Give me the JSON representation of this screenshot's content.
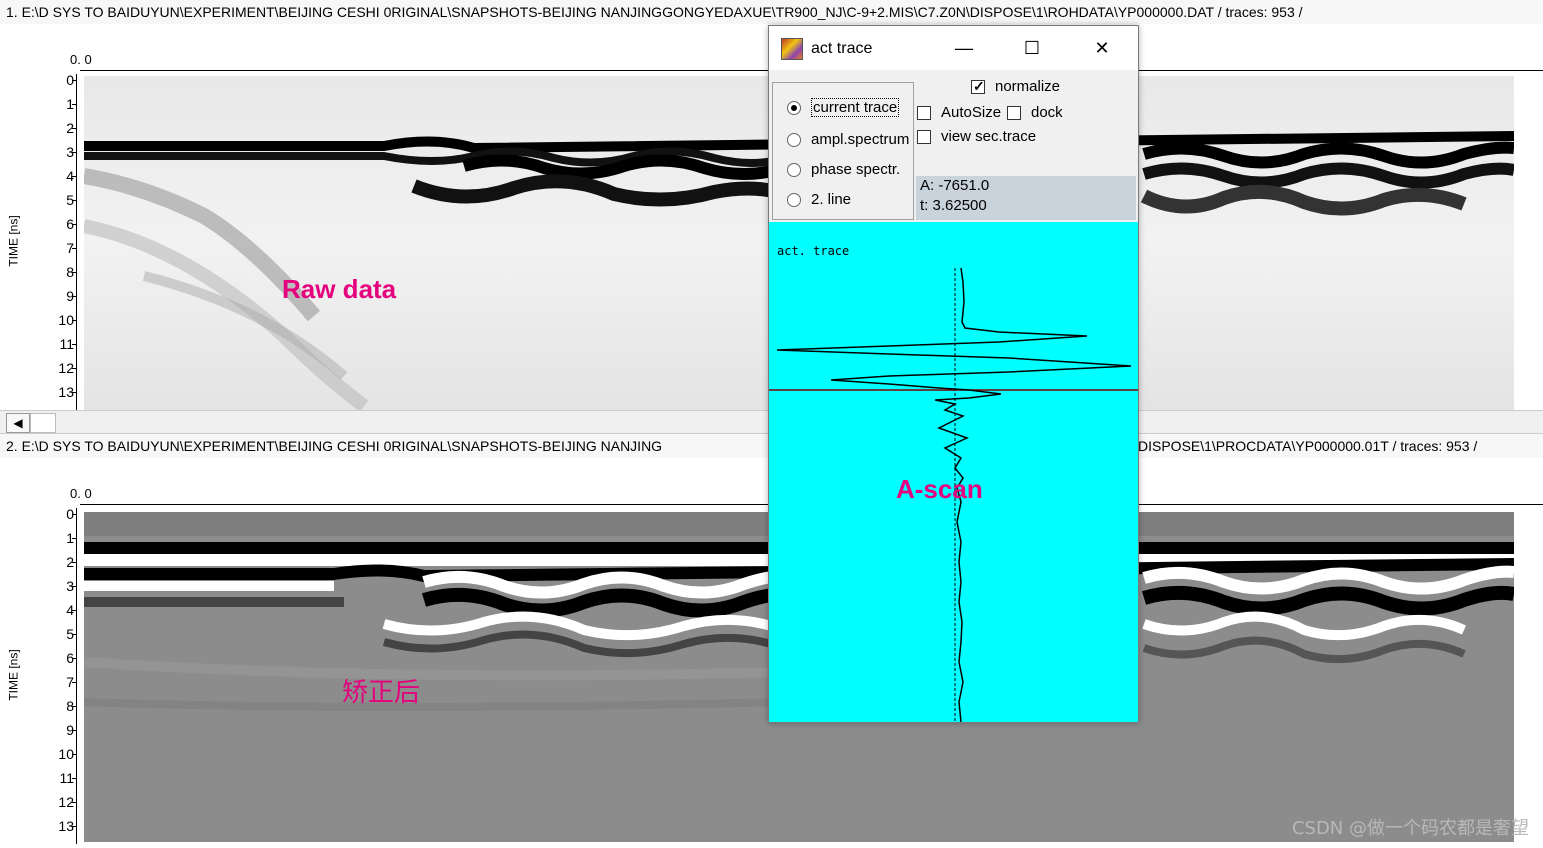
{
  "panel1": {
    "title": "1. E:\\D SYS TO BAIDUYUN\\EXPERIMENT\\BEIJING CESHI 0RIGINAL\\SNAPSHOTS-BEIJING NANJINGGONGYEDAXUE\\TR900_NJ\\C-9+2.MIS\\C7.Z0N\\DISPOSE\\1\\ROHDATA\\YP000000.DAT / traces: 953 /",
    "zero_label": "0. 0",
    "y_title": "TIME [ns]",
    "y_ticks": [
      "0",
      "1",
      "2",
      "3",
      "4",
      "5",
      "6",
      "7",
      "8",
      "9",
      "10",
      "11",
      "12",
      "13"
    ],
    "annotation": "Raw data"
  },
  "panel2": {
    "title": "2. E:\\D SYS TO BAIDUYUN\\EXPERIMENT\\BEIJING CESHI 0RIGINAL\\SNAPSHOTS-BEIJING NANJING",
    "title_right": "DISPOSE\\1\\PROCDATA\\YP000000.01T / traces: 953 /",
    "zero_label": "0. 0",
    "y_title": "TIME [ns]",
    "y_ticks": [
      "0",
      "1",
      "2",
      "3",
      "4",
      "5",
      "6",
      "7",
      "8",
      "9",
      "10",
      "11",
      "12",
      "13"
    ],
    "annotation": "矫正后"
  },
  "scrollbar": {
    "left_arrow": "◀"
  },
  "dialog": {
    "title": "act trace",
    "minimize": "—",
    "maximize": "☐",
    "close": "✕",
    "radio_options": [
      {
        "label": "current trace",
        "selected": true
      },
      {
        "label": "ampl.spectrum",
        "selected": false
      },
      {
        "label": "phase spectr.",
        "selected": false
      },
      {
        "label": "2. line",
        "selected": false
      }
    ],
    "checkboxes": {
      "normalize": {
        "label": "normalize",
        "checked": true
      },
      "autosize": {
        "label": "AutoSize",
        "checked": false
      },
      "dock": {
        "label": "dock",
        "checked": false
      },
      "view_sec_trace": {
        "label": "view sec.trace",
        "checked": false
      }
    },
    "readout": {
      "a": "A: -7651.0",
      "t": "t: 3.62500"
    },
    "trace_label": "act. trace",
    "annotation": "A-scan",
    "trace_bg": "#00ffff"
  },
  "watermark": "CSDN @做一个码农都是奢望",
  "colors": {
    "annotation": "#e5007e"
  }
}
